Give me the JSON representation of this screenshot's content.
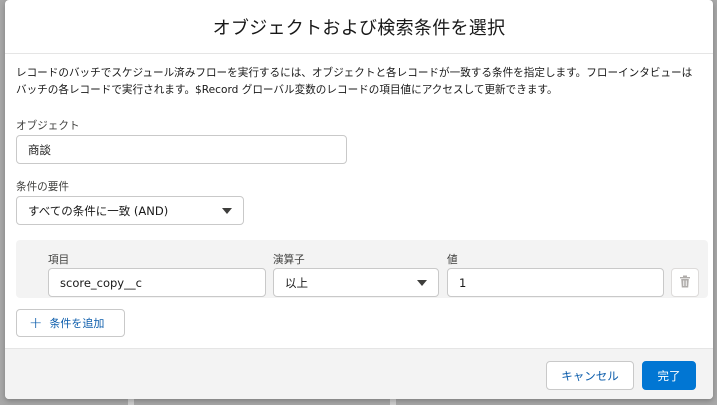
{
  "modal": {
    "title": "オブジェクトおよび検索条件を選択",
    "description_line1": "レコードのバッチでスケジュール済みフローを実行するには、オブジェクトと各レコードが一致する条件を指定します。フローインタビューは",
    "description_line2": "バッチの各レコードで実行されます。$Record グローバル変数のレコードの項目値にアクセスして更新できます。"
  },
  "object_field": {
    "label": "オブジェクト",
    "value": "商談"
  },
  "requirement_field": {
    "label": "条件の要件",
    "value": "すべての条件に一致 (AND)"
  },
  "condition": {
    "field_label": "項目",
    "field_value": "score_copy__c",
    "operator_label": "演算子",
    "operator_value": "以上",
    "value_label": "値",
    "value_value": "1"
  },
  "add_condition_label": "条件を追加",
  "footer": {
    "cancel_label": "キャンセル",
    "done_label": "完了"
  },
  "colors": {
    "brand": "#0176d3",
    "link": "#0b5cab",
    "border": "#c9c9c9",
    "condition_bg": "#f3f3f3"
  },
  "icons": [
    "trash-icon",
    "plus-icon",
    "chevron-down-icon"
  ]
}
